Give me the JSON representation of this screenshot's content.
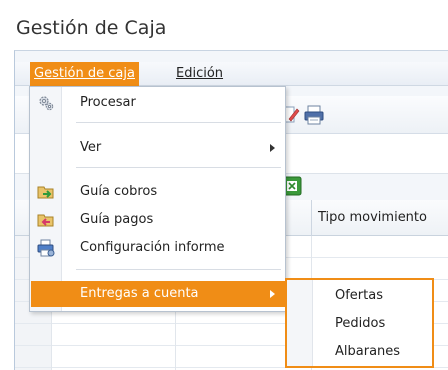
{
  "window": {
    "title": "Gestión de Caja"
  },
  "menubar": {
    "items": [
      {
        "label": "Gestión de caja",
        "active": true
      },
      {
        "label": "Edición",
        "active": false
      }
    ]
  },
  "grid": {
    "columns": [
      "Tipo movimiento"
    ]
  },
  "dropdown": {
    "items": [
      {
        "label": "Procesar",
        "icon": "gears-icon"
      },
      {
        "label": "Ver",
        "icon": "",
        "has_submenu": true
      },
      {
        "label": "Guía cobros",
        "icon": "folder-green-arrow-icon"
      },
      {
        "label": "Guía pagos",
        "icon": "folder-red-arrow-icon"
      },
      {
        "label": "Configuración informe",
        "icon": "printer-config-icon"
      },
      {
        "label": "Entregas a cuenta",
        "icon": "",
        "has_submenu": true,
        "highlighted": true
      }
    ]
  },
  "submenu": {
    "items": [
      {
        "label": "Ofertas"
      },
      {
        "label": "Pedidos"
      },
      {
        "label": "Albaranes"
      }
    ]
  },
  "colors": {
    "accent": "#f08d16",
    "border": "#b7c2cf"
  }
}
